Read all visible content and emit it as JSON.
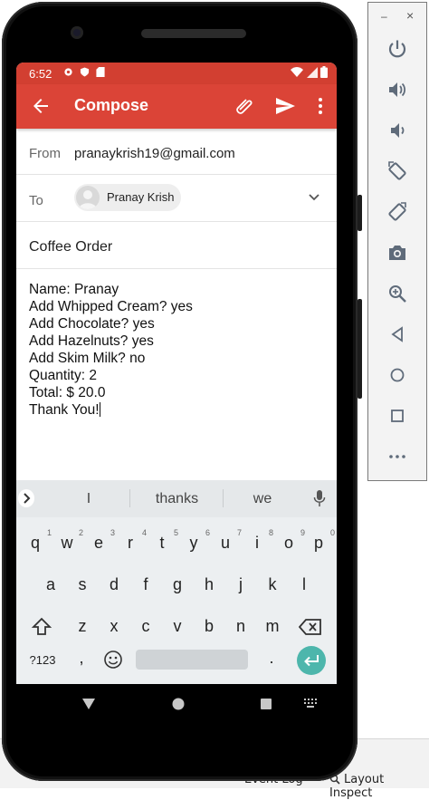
{
  "status_bar": {
    "time": "6:52",
    "left_icons": [
      "gear-icon",
      "shield-icon",
      "sim-icon"
    ],
    "right_icons": [
      "wifi-icon",
      "signal-icon",
      "battery-icon"
    ]
  },
  "app_bar": {
    "title": "Compose",
    "actions": [
      "attach-icon",
      "send-icon",
      "more-vert-icon"
    ]
  },
  "compose": {
    "from_label": "From",
    "from_value": "pranaykrish19@gmail.com",
    "to_label": "To",
    "to_chip": "Pranay Krish",
    "subject": "Coffee Order",
    "body_lines": [
      "Name: Pranay",
      "Add Whipped Cream? yes",
      "Add Chocolate? yes",
      "Add Hazelnuts? yes",
      "Add Skim Milk? no",
      "Quantity: 2",
      "Total: $ 20.0",
      "Thank You!"
    ]
  },
  "keyboard": {
    "suggestions": [
      "I",
      "thanks",
      "we"
    ],
    "row1": [
      "q",
      "w",
      "e",
      "r",
      "t",
      "y",
      "u",
      "i",
      "o",
      "p"
    ],
    "row1_hints": [
      "1",
      "2",
      "3",
      "4",
      "5",
      "6",
      "7",
      "8",
      "9",
      "0"
    ],
    "row2": [
      "a",
      "s",
      "d",
      "f",
      "g",
      "h",
      "j",
      "k",
      "l"
    ],
    "row3": [
      "z",
      "x",
      "c",
      "v",
      "b",
      "n",
      "m"
    ],
    "symbols_key": "?123",
    "comma_key": ",",
    "period_key": "."
  },
  "emulator_panel": {
    "minimize": "–",
    "close": "×",
    "tools": [
      "power-icon",
      "volume-up-icon",
      "volume-down-icon",
      "rotate-left-icon",
      "rotate-right-icon",
      "camera-icon",
      "zoom-icon",
      "back-icon",
      "home-icon",
      "overview-icon",
      "more-icon"
    ]
  },
  "ide": {
    "event_log": "Event Log",
    "layout_inspector": "Layout Inspect"
  },
  "colors": {
    "app_bar": "#db4437",
    "status_bar": "#d23f31",
    "enter_key": "#4db6ac"
  }
}
